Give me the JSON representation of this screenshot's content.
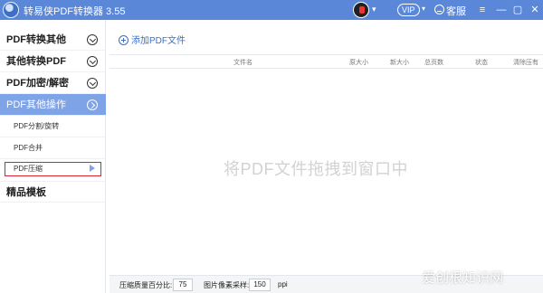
{
  "app": {
    "title": "转易侠PDF转换器 3.55",
    "vip_label": "VIP",
    "support_label": "客服"
  },
  "sidebar": {
    "items": [
      {
        "label": "PDF转换其他"
      },
      {
        "label": "其他转换PDF"
      },
      {
        "label": "PDF加密/解密"
      },
      {
        "label": "PDF其他操作"
      }
    ],
    "sub_items": [
      {
        "label": "PDF分割/旋转"
      },
      {
        "label": "PDF合并"
      },
      {
        "label": "PDF压缩"
      }
    ],
    "bottom_item": {
      "label": "精品模板"
    }
  },
  "main": {
    "add_file_label": "添加PDF文件",
    "columns": [
      "文件名",
      "原大小",
      "新大小",
      "总页数",
      "状态",
      "清除压有"
    ],
    "drop_hint": "将PDF文件拖拽到窗口中"
  },
  "settings": {
    "quality_label": "压缩质量百分比:",
    "quality_value": "75",
    "dpi_label": "图片像素采样:",
    "dpi_value": "150",
    "dpi_unit": "ppi"
  },
  "watermark": "爱创根知识网",
  "colors": {
    "titlebar": "#5b87d8",
    "active_nav": "#7ea3e6",
    "highlight_border": "#d9232d",
    "accent": "#3d6fc4"
  },
  "icons": [
    "app-logo-icon",
    "user-avatar-icon",
    "support-icon",
    "minimize-icon",
    "maximize-icon",
    "close-icon",
    "menu-icon",
    "chevron-down-icon",
    "plus-circle-icon",
    "arrow-right-icon"
  ]
}
